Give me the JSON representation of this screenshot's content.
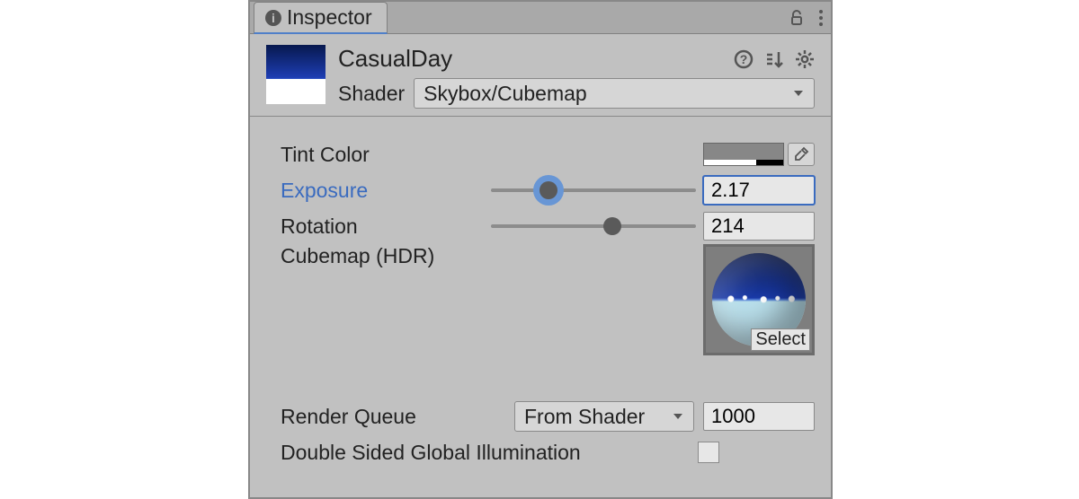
{
  "tab": {
    "title": "Inspector"
  },
  "header": {
    "material_name": "CasualDay",
    "shader_label": "Shader",
    "shader_value": "Skybox/Cubemap"
  },
  "props": {
    "tint_label": "Tint Color",
    "tint_hex": "#878787",
    "exposure_label": "Exposure",
    "exposure_value": "2.17",
    "exposure_slider_pct": 28,
    "rotation_label": "Rotation",
    "rotation_value": "214",
    "rotation_slider_pct": 59,
    "cubemap_label": "Cubemap   (HDR)",
    "cubemap_select_label": "Select"
  },
  "footer": {
    "render_queue_label": "Render Queue",
    "render_queue_mode": "From Shader",
    "render_queue_value": "1000",
    "dsgi_label": "Double Sided Global Illumination",
    "dsgi_checked": false
  }
}
